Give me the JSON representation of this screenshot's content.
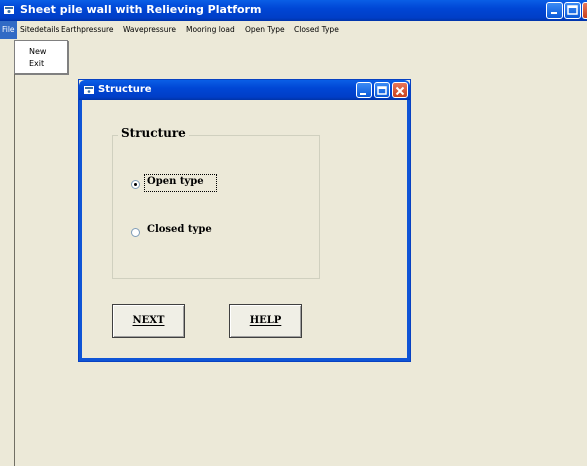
{
  "window": {
    "title": "Sheet pile wall with Relieving Platform"
  },
  "menubar": {
    "items": [
      "File",
      "Sitedetails",
      "Earthpressure",
      "Wavepressure",
      "Mooring load",
      "Open Type",
      "Closed Type"
    ]
  },
  "file_menu": {
    "items": [
      "New",
      "Exit"
    ]
  },
  "dialog": {
    "title": "Structure",
    "group_label": "Structure",
    "options": [
      {
        "label": "Open type",
        "selected": true
      },
      {
        "label": "Closed type",
        "selected": false
      }
    ],
    "next_label": "NEXT",
    "help_label": "HELP"
  },
  "colors": {
    "titlebar": "#0046d5",
    "background": "#ece9d8",
    "menu_highlight": "#316ac5",
    "close_button": "#c9401d"
  }
}
